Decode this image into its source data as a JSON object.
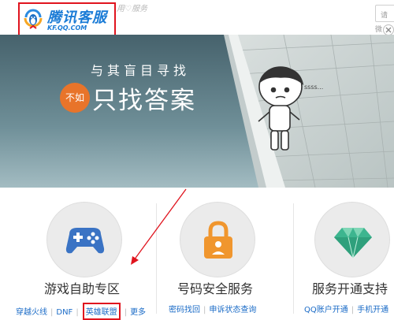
{
  "header": {
    "logo_title": "腾讯客服",
    "logo_url": "KF.QQ.COM",
    "slogan": "用♡服务",
    "login_placeholder": "请",
    "wechat_label": "微",
    "close_symbol": "×"
  },
  "banner": {
    "line1": "与其盲目寻找",
    "badge": "不如",
    "line2": "只找答案",
    "speech": "ssss..."
  },
  "services": [
    {
      "icon": "gamepad-icon",
      "title": "游戏自助专区",
      "links": [
        "穿越火线",
        "DNF",
        "英雄联盟",
        "更多"
      ]
    },
    {
      "icon": "lock-icon",
      "title": "号码安全服务",
      "links": [
        "密码找回",
        "申诉状态查询"
      ]
    },
    {
      "icon": "diamond-icon",
      "title": "服务开通支持",
      "links": [
        "QQ账户开通",
        "手机开通"
      ]
    }
  ],
  "colors": {
    "brand_blue": "#1a7bd6",
    "annotation_red": "#e0141e",
    "link_blue": "#1a6bc7",
    "lock_orange": "#f0962e",
    "diamond_green": "#3db58f"
  }
}
